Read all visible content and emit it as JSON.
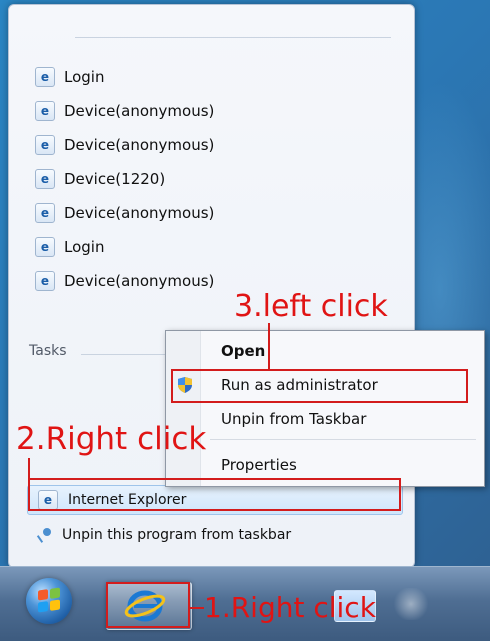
{
  "jump_list": {
    "recent_items": [
      {
        "label": "Login",
        "icon": "ie-page-icon"
      },
      {
        "label": "Device(anonymous)",
        "icon": "ie-page-icon"
      },
      {
        "label": "Device(anonymous)",
        "icon": "ie-page-icon"
      },
      {
        "label": "Device(1220)",
        "icon": "ie-page-icon"
      },
      {
        "label": "Device(anonymous)",
        "icon": "ie-page-icon"
      },
      {
        "label": "Login",
        "icon": "ie-page-icon"
      },
      {
        "label": "Device(anonymous)",
        "icon": "ie-page-icon"
      }
    ],
    "tasks_label": "Tasks",
    "pinned_program_label": "Internet Explorer",
    "unpin_label": "Unpin this program from taskbar"
  },
  "context_menu": {
    "items": [
      {
        "label": "Open",
        "bold": true
      },
      {
        "label": "Run as administrator",
        "icon": "shield-icon"
      },
      {
        "label": "Unpin from Taskbar"
      },
      {
        "label": "Properties"
      }
    ]
  },
  "taskbar": {
    "start_button_icon": "windows-start-orb",
    "pinned_icon": "internet-explorer-icon"
  },
  "annotations": {
    "step1": "1.Right click",
    "step2": "2.Right click",
    "step3": "3.left click",
    "color": "#e01414"
  }
}
